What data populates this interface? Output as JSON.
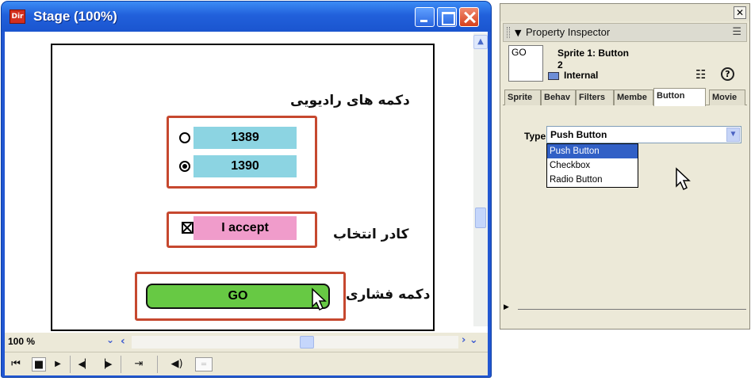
{
  "stage": {
    "app_icon": "Dir",
    "title": "Stage (100%)",
    "zoom": "100 %",
    "radio_heading": "دکمه های رادیویی",
    "radio_options": [
      "1389",
      "1390"
    ],
    "radio_selected_index": 1,
    "checkbox_heading": "کادر انتخاب",
    "checkbox_label": "I accept",
    "pushbutton_heading": "دکمه فشاری",
    "pushbutton_label": "GO",
    "colors": {
      "radio_bg": "#8cd4e2",
      "checkbox_bg": "#f09ccb",
      "button_bg": "#67c944",
      "highlight_border": "#c6482f"
    },
    "controls": [
      "rewind-icon",
      "stop-icon",
      "play-icon",
      "step-back-icon",
      "step-forward-icon",
      "loop-icon",
      "volume-icon",
      "options-icon"
    ]
  },
  "inspector": {
    "panel_title": "Property Inspector",
    "thumb_label": "GO",
    "sprite_label": "Sprite 1: Button",
    "sprite_number": "2",
    "cast_label": "Internal",
    "tabs": [
      "Sprite",
      "Behav",
      "Filters",
      "Membe",
      "Button",
      "Movie"
    ],
    "active_tab": "Button",
    "type_label": "Type:",
    "type_value": "Push Button",
    "type_options": [
      "Push Button",
      "Checkbox",
      "Radio Button"
    ]
  }
}
